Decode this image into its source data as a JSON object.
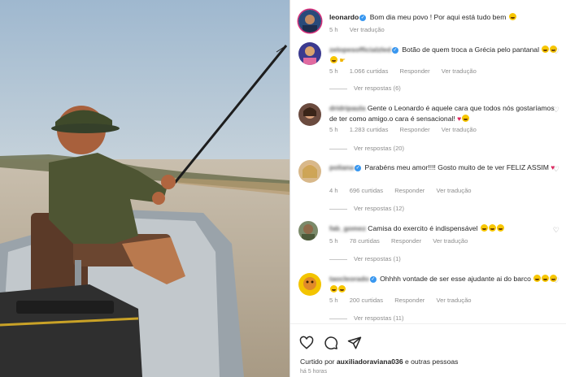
{
  "post": {
    "author": "leonardo",
    "caption": "Bom dia meu povo ! Por aqui está tudo bem",
    "time": "5 h",
    "translate": "Ver tradução"
  },
  "comments": [
    {
      "user": "zelopesofficialzled",
      "text": "Botão de quem troca a Grécia pelo pantanal",
      "time": "5 h",
      "likes": "1.066 curtidas",
      "reply": "Responder",
      "translate": "Ver tradução",
      "view_replies": "Ver respostas (6)"
    },
    {
      "user": "dridripaula",
      "text": "Gente o Leonardo é aquele cara que todos nós gostaríamos de ter como amigo.o cara é sensacional!",
      "time": "5 h",
      "likes": "1.283 curtidas",
      "reply": "Responder",
      "translate": "Ver tradução",
      "view_replies": "Ver respostas (20)"
    },
    {
      "user": "poliana",
      "text": "Parabéns meu amor!!!! Gosto muito de te ver FELIZ ASSIM",
      "time": "4 h",
      "likes": "696 curtidas",
      "reply": "Responder",
      "translate": "Ver tradução",
      "view_replies": "Ver respostas (12)"
    },
    {
      "user": "fab_gomez",
      "text": "Camisa do exercito é indispensável",
      "time": "5 h",
      "likes": "78 curtidas",
      "reply": "Responder",
      "translate": "Ver tradução",
      "view_replies": "Ver respostas (1)"
    },
    {
      "user": "taocleorado",
      "text": "Ohhhh vontade de ser esse ajudante ai do barco",
      "time": "5 h",
      "likes": "200 curtidas",
      "reply": "Responder",
      "translate": "Ver tradução",
      "view_replies": "Ver respostas (11)"
    }
  ],
  "footer": {
    "liked_prefix": "Curtido por",
    "liked_user": "auxiliadoraviana036",
    "liked_suffix": "e outras pessoas",
    "time": "há 5 horas"
  },
  "icons": [
    "heart-icon",
    "comment-icon",
    "share-icon",
    "verified-icon",
    "sunglasses-emoji",
    "laughing-emoji",
    "heart-emoji",
    "pointing-hand-emoji"
  ],
  "colors": {
    "verified": "#3897f0",
    "heart": "#e0245e",
    "meta": "#8e8e8e"
  }
}
